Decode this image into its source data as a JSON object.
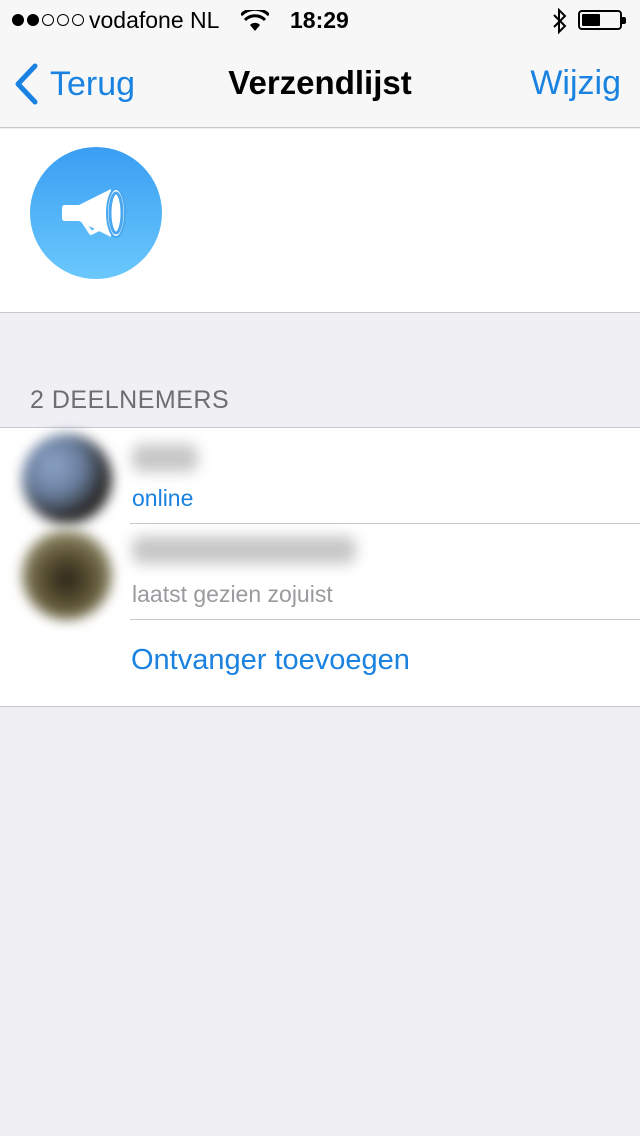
{
  "status_bar": {
    "carrier": "vodafone NL",
    "time": "18:29",
    "signal_bars_filled": 2,
    "signal_bars_total": 5
  },
  "nav": {
    "back_label": "Terug",
    "title": "Verzendlijst",
    "edit_label": "Wijzig"
  },
  "section": {
    "participants_header": "2 DEELNEMERS"
  },
  "participants": [
    {
      "name": "",
      "status": "online"
    },
    {
      "name": "",
      "status": "laatst gezien zojuist"
    }
  ],
  "actions": {
    "add_recipient": "Ontvanger toevoegen"
  },
  "colors": {
    "accent": "#1a82e0",
    "background": "#efeff4",
    "avatar_gradient_top": "#3a9ef3",
    "avatar_gradient_bottom": "#6ac8fc"
  },
  "icons": [
    "chevron-left-icon",
    "megaphone-icon",
    "wifi-icon",
    "bluetooth-icon",
    "battery-icon"
  ]
}
